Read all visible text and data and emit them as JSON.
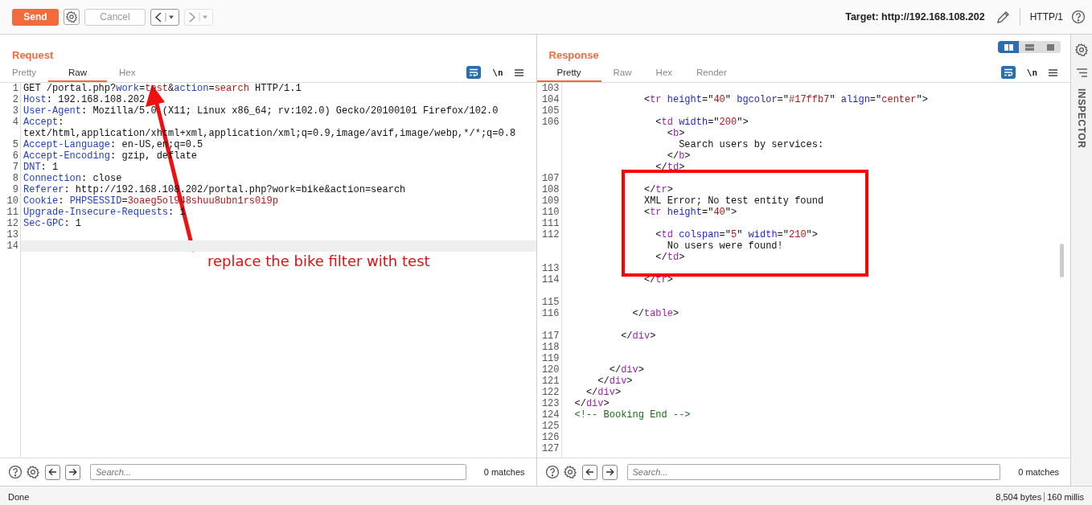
{
  "toolbar": {
    "send": "Send",
    "cancel": {
      "label": "Cancel",
      "disabled": true
    },
    "back": {
      "disabled": false
    },
    "forward": {
      "disabled": true
    },
    "target": "Target: http://192.168.108.202",
    "protocol": "HTTP/1"
  },
  "request": {
    "title": "Request",
    "tabs": [
      {
        "label": "Pretty",
        "selected": false
      },
      {
        "label": "Raw",
        "selected": true
      },
      {
        "label": "Hex",
        "selected": false
      }
    ],
    "wrap_on": true,
    "newline_toggle": "\\n",
    "lines": [
      {
        "number": "1",
        "highlighted": false,
        "tokens": [
          {
            "kind": "plain",
            "text": "GET /portal.php?"
          },
          {
            "kind": "key",
            "text": "work"
          },
          {
            "kind": "plain",
            "text": "="
          },
          {
            "kind": "val",
            "text": "test"
          },
          {
            "kind": "plain",
            "text": "&"
          },
          {
            "kind": "key",
            "text": "action"
          },
          {
            "kind": "plain",
            "text": "="
          },
          {
            "kind": "val",
            "text": "search"
          },
          {
            "kind": "plain",
            "text": " HTTP/1.1"
          }
        ]
      },
      {
        "number": "2",
        "highlighted": false,
        "tokens": [
          {
            "kind": "key",
            "text": "Host"
          },
          {
            "kind": "plain",
            "text": ": 192.168.108.202"
          }
        ]
      },
      {
        "number": "3",
        "highlighted": false,
        "tokens": [
          {
            "kind": "key",
            "text": "User-Agent"
          },
          {
            "kind": "plain",
            "text": ": Mozilla/5.0 (X11; Linux x86_64; rv:102.0) Gecko/20100101 Firefox/102.0"
          }
        ]
      },
      {
        "number": "4",
        "highlighted": false,
        "tokens": [
          {
            "kind": "key",
            "text": "Accept"
          },
          {
            "kind": "plain",
            "text": ":"
          }
        ]
      },
      {
        "highlighted": false,
        "tokens": [
          {
            "kind": "plain",
            "text": "text/html,application/xhtml+xml,application/xml;q=0.9,image/avif,image/webp,*/*;q=0.8"
          }
        ]
      },
      {
        "number": "5",
        "highlighted": false,
        "tokens": [
          {
            "kind": "key",
            "text": "Accept-Language"
          },
          {
            "kind": "plain",
            "text": ": en-US,en;q=0.5"
          }
        ]
      },
      {
        "number": "6",
        "highlighted": false,
        "tokens": [
          {
            "kind": "key",
            "text": "Accept-Encoding"
          },
          {
            "kind": "plain",
            "text": ": gzip, deflate"
          }
        ]
      },
      {
        "number": "7",
        "highlighted": false,
        "tokens": [
          {
            "kind": "key",
            "text": "DNT"
          },
          {
            "kind": "plain",
            "text": ": 1"
          }
        ]
      },
      {
        "number": "8",
        "highlighted": false,
        "tokens": [
          {
            "kind": "key",
            "text": "Connection"
          },
          {
            "kind": "plain",
            "text": ": close"
          }
        ]
      },
      {
        "number": "9",
        "highlighted": false,
        "tokens": [
          {
            "kind": "key",
            "text": "Referer"
          },
          {
            "kind": "plain",
            "text": ": http://192.168.108.202/portal.php?work=bike&action=search"
          }
        ]
      },
      {
        "number": "10",
        "highlighted": false,
        "tokens": [
          {
            "kind": "key",
            "text": "Cookie"
          },
          {
            "kind": "plain",
            "text": ": "
          },
          {
            "kind": "key",
            "text": "PHPSESSID"
          },
          {
            "kind": "plain",
            "text": "="
          },
          {
            "kind": "val",
            "text": "3oaeg5ol948shuu8ubn1rs0i9p"
          }
        ]
      },
      {
        "number": "11",
        "highlighted": false,
        "tokens": [
          {
            "kind": "key",
            "text": "Upgrade-Insecure-Requests"
          },
          {
            "kind": "plain",
            "text": ": 1"
          }
        ]
      },
      {
        "number": "12",
        "highlighted": false,
        "tokens": [
          {
            "kind": "key",
            "text": "Sec-GPC"
          },
          {
            "kind": "plain",
            "text": ": 1"
          }
        ]
      },
      {
        "number": "13",
        "highlighted": false
      },
      {
        "number": "14",
        "highlighted": true
      }
    ],
    "annotation": {
      "kind": "arrow",
      "text": "replace the bike filter with test"
    },
    "search": {
      "placeholder": "Search...",
      "matches": "0 matches"
    }
  },
  "response": {
    "title": "Response",
    "layout_modes": [
      {
        "selected": true
      },
      {
        "selected": false
      },
      {
        "selected": false
      }
    ],
    "tabs": [
      {
        "label": "Pretty",
        "selected": true
      },
      {
        "label": "Raw",
        "selected": false
      },
      {
        "label": "Hex",
        "selected": false
      },
      {
        "label": "Render",
        "selected": false
      }
    ],
    "wrap_on": true,
    "newline_toggle": "\\n",
    "lines": [
      {
        "number": "103"
      },
      {
        "number": "104",
        "tokens": [
          {
            "kind": "plain",
            "text": "            <"
          },
          {
            "kind": "tag",
            "text": "tr"
          },
          {
            "kind": "attr",
            "text": " height"
          },
          {
            "kind": "plain",
            "text": "=\""
          },
          {
            "kind": "str",
            "text": "40"
          },
          {
            "kind": "plain",
            "text": "\" "
          },
          {
            "kind": "attr",
            "text": "bgcolor"
          },
          {
            "kind": "plain",
            "text": "=\""
          },
          {
            "kind": "str",
            "text": "#17ffb7"
          },
          {
            "kind": "plain",
            "text": "\" "
          },
          {
            "kind": "attr",
            "text": "align"
          },
          {
            "kind": "plain",
            "text": "=\""
          },
          {
            "kind": "str",
            "text": "center"
          },
          {
            "kind": "plain",
            "text": "\">"
          }
        ]
      },
      {
        "number": "105"
      },
      {
        "number": "106",
        "tokens": [
          {
            "kind": "plain",
            "text": "              <"
          },
          {
            "kind": "tag",
            "text": "td"
          },
          {
            "kind": "attr",
            "text": " width"
          },
          {
            "kind": "plain",
            "text": "=\""
          },
          {
            "kind": "str",
            "text": "200"
          },
          {
            "kind": "plain",
            "text": "\">"
          }
        ]
      },
      {
        "tokens": [
          {
            "kind": "plain",
            "text": "                <"
          },
          {
            "kind": "tag",
            "text": "b"
          },
          {
            "kind": "plain",
            "text": ">"
          }
        ]
      },
      {
        "tokens": [
          {
            "kind": "plain",
            "text": "                  Search users by services:"
          }
        ]
      },
      {
        "tokens": [
          {
            "kind": "plain",
            "text": "                </"
          },
          {
            "kind": "tag",
            "text": "b"
          },
          {
            "kind": "plain",
            "text": ">"
          }
        ]
      },
      {
        "tokens": [
          {
            "kind": "plain",
            "text": "              </"
          },
          {
            "kind": "tag",
            "text": "td"
          },
          {
            "kind": "plain",
            "text": ">"
          }
        ]
      },
      {
        "number": "107"
      },
      {
        "number": "108",
        "tokens": [
          {
            "kind": "plain",
            "text": "            </"
          },
          {
            "kind": "tag",
            "text": "tr"
          },
          {
            "kind": "plain",
            "text": ">"
          }
        ]
      },
      {
        "number": "109",
        "tokens": [
          {
            "kind": "plain",
            "text": "            XML Error; No test entity found"
          }
        ]
      },
      {
        "number": "110",
        "tokens": [
          {
            "kind": "plain",
            "text": "            <"
          },
          {
            "kind": "tag",
            "text": "tr"
          },
          {
            "kind": "attr",
            "text": " height"
          },
          {
            "kind": "plain",
            "text": "=\""
          },
          {
            "kind": "str",
            "text": "40"
          },
          {
            "kind": "plain",
            "text": "\">"
          }
        ]
      },
      {
        "number": "111"
      },
      {
        "number": "112",
        "tokens": [
          {
            "kind": "plain",
            "text": "              <"
          },
          {
            "kind": "tag",
            "text": "td"
          },
          {
            "kind": "attr",
            "text": " colspan"
          },
          {
            "kind": "plain",
            "text": "=\""
          },
          {
            "kind": "str",
            "text": "5"
          },
          {
            "kind": "plain",
            "text": "\" "
          },
          {
            "kind": "attr",
            "text": "width"
          },
          {
            "kind": "plain",
            "text": "=\""
          },
          {
            "kind": "str",
            "text": "210"
          },
          {
            "kind": "plain",
            "text": "\">"
          }
        ]
      },
      {
        "tokens": [
          {
            "kind": "plain",
            "text": "                No users were found!"
          }
        ]
      },
      {
        "tokens": [
          {
            "kind": "plain",
            "text": "              </"
          },
          {
            "kind": "tag",
            "text": "td"
          },
          {
            "kind": "plain",
            "text": ">"
          }
        ]
      },
      {
        "number": "113"
      },
      {
        "number": "114",
        "trailing_blank": true,
        "tokens": [
          {
            "kind": "plain",
            "text": "            </"
          },
          {
            "kind": "tag",
            "text": "tr"
          },
          {
            "kind": "plain",
            "text": ">"
          }
        ]
      },
      {
        "number": "115"
      },
      {
        "number": "116",
        "trailing_blank": true,
        "tokens": [
          {
            "kind": "plain",
            "text": "          </"
          },
          {
            "kind": "tag",
            "text": "table"
          },
          {
            "kind": "plain",
            "text": ">"
          }
        ]
      },
      {
        "number": "117",
        "tokens": [
          {
            "kind": "plain",
            "text": "        </"
          },
          {
            "kind": "tag",
            "text": "div"
          },
          {
            "kind": "plain",
            "text": ">"
          }
        ]
      },
      {
        "number": "118"
      },
      {
        "number": "119"
      },
      {
        "number": "120",
        "tokens": [
          {
            "kind": "plain",
            "text": "      </"
          },
          {
            "kind": "tag",
            "text": "div"
          },
          {
            "kind": "plain",
            "text": ">"
          }
        ]
      },
      {
        "number": "121",
        "tokens": [
          {
            "kind": "plain",
            "text": "    </"
          },
          {
            "kind": "tag",
            "text": "div"
          },
          {
            "kind": "plain",
            "text": ">"
          }
        ]
      },
      {
        "number": "122",
        "tokens": [
          {
            "kind": "plain",
            "text": "  </"
          },
          {
            "kind": "tag",
            "text": "div"
          },
          {
            "kind": "plain",
            "text": ">"
          }
        ]
      },
      {
        "number": "123",
        "tokens": [
          {
            "kind": "plain",
            "text": "</"
          },
          {
            "kind": "tag",
            "text": "div"
          },
          {
            "kind": "plain",
            "text": ">"
          }
        ]
      },
      {
        "number": "124",
        "tokens": [
          {
            "kind": "comment",
            "text": "<!-- Booking End -->"
          }
        ]
      },
      {
        "number": "125"
      },
      {
        "number": "126"
      },
      {
        "number": "127"
      }
    ],
    "callout": {
      "kind": "box"
    },
    "search": {
      "placeholder": "Search...",
      "matches": "0 matches"
    }
  },
  "inspector": {
    "label": "INSPECTOR"
  },
  "status_bar": {
    "state": "Done",
    "bytes": "8,504 bytes",
    "time": "160 millis"
  }
}
